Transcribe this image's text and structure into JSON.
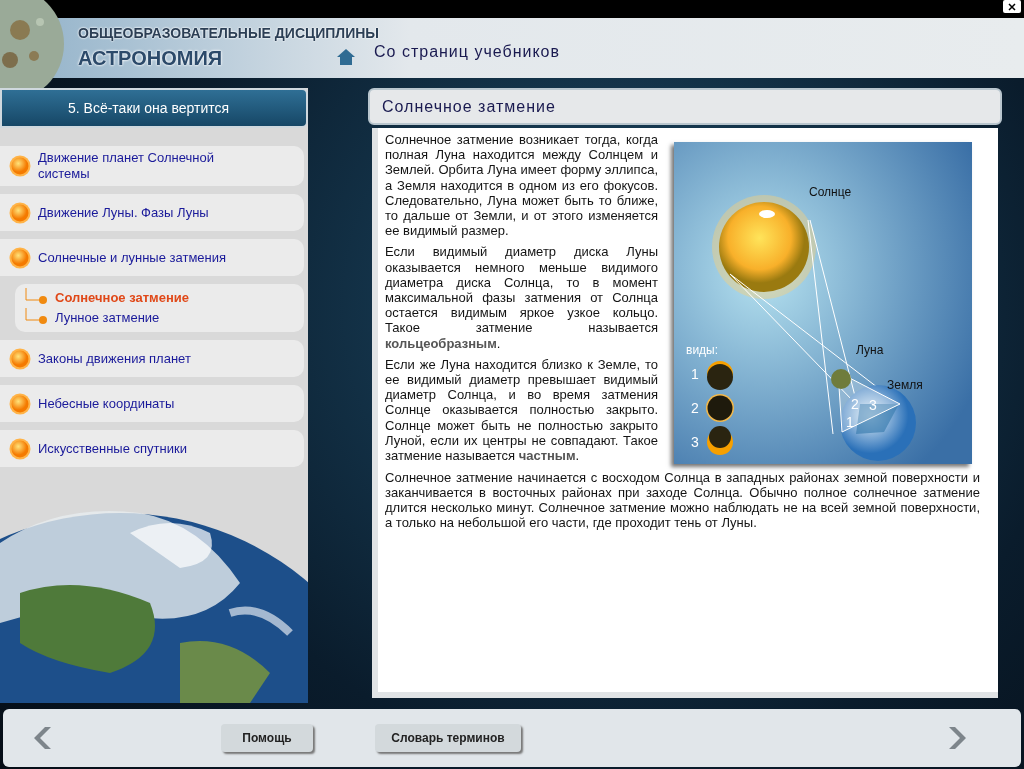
{
  "header": {
    "subtitle": "ОБЩЕОБРАЗОВАТЕЛЬНЫЕ ДИСЦИПЛИНЫ",
    "title": "АСТРОНОМИЯ",
    "section": "Со страниц учебников"
  },
  "sidebar": {
    "title": "5. Всё-таки она вертится",
    "items": [
      {
        "label": "Движение планет Солнечной системы"
      },
      {
        "label": "Движение Луны. Фазы Луны"
      },
      {
        "label": "Солнечные и лунные затмения",
        "children": [
          {
            "label": "Солнечное затмение",
            "selected": true
          },
          {
            "label": "Лунное затмение",
            "selected": false
          }
        ]
      },
      {
        "label": "Законы движения планет"
      },
      {
        "label": "Небесные координаты"
      },
      {
        "label": "Искусственные спутники"
      }
    ]
  },
  "content": {
    "title": "Солнечное затмение",
    "paragraphs": [
      "Солнечное затмение возникает тогда, когда полная Луна находится между Солнцем и Землей. Орбита Луна имеет форму эллипса, а Земля находится в одном из его фокусов. Следовательно, Луна может быть то ближе, то дальше от Земли, и от этого изменяется ее видимый размер.",
      "Если видимый диаметр диска Луны оказывается немного меньше видимого диаметра диска Солнца, то в момент максимальной фазы затмения от Солнца остается видимым яркое узкое кольцо. Такое затмение называется **кольцеобразным**.",
      "Если же Луна находится близко к Земле, то ее видимый диаметр превышает видимый диаметр Солнца, и во время затмения Солнце оказывается полностью закрыто. Солнце может быть не полностью закрыто Луной, если их центры не совпадают. Такое затмение называется **частным**."
    ],
    "wide_paragraph": "Солнечное затмение начинается с восходом Солнца в западных районах земной поверхности и заканчивается в восточных районах при заходе Солнца. Обычно полное солнечное затмение длится несколько минут. Солнечное затмение можно наблюдать не на всей земной поверхности, а только на небольшой его части, где проходит тень от Луны.",
    "diagram": {
      "sun_label": "Солнце",
      "moon_label": "Луна",
      "earth_label": "Земля",
      "types_label": "виды:",
      "types": [
        {
          "label": "1",
          "kind": "top"
        },
        {
          "label": "2",
          "kind": "ring"
        },
        {
          "label": "3",
          "kind": "bottom"
        }
      ],
      "zone_labels": [
        "2",
        "3",
        "1"
      ]
    }
  },
  "footer": {
    "buttons": [
      "Помощь",
      "Словарь терминов"
    ]
  }
}
